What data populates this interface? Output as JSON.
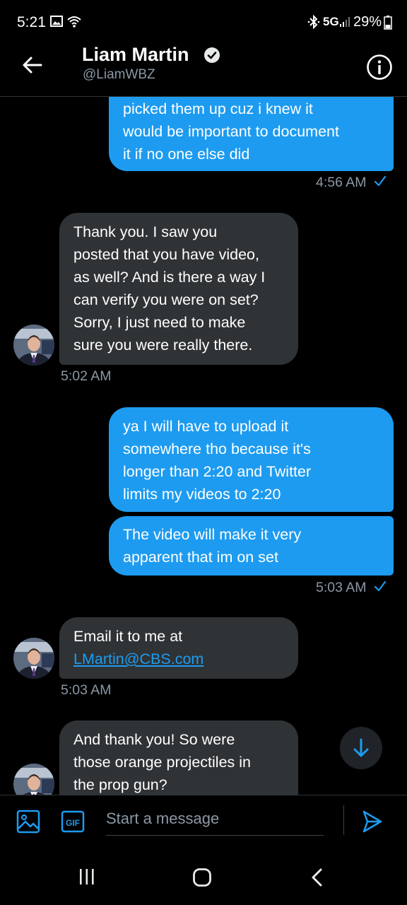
{
  "status_bar": {
    "time": "5:21",
    "network": "5G",
    "battery": "29%",
    "icons": [
      "gallery-icon",
      "wifi-icon",
      "bluetooth-icon",
      "signal-icon",
      "battery-icon"
    ]
  },
  "header": {
    "name": "Liam Martin",
    "handle": "@LiamWBZ",
    "verified": true,
    "back_icon": "arrow-left-icon",
    "info_icon": "info-icon"
  },
  "messages": [
    {
      "direction": "sent",
      "lines": [
        "picked them up cuz i knew it",
        "would be important to document",
        "it if no one else did"
      ]
    },
    {
      "type": "timestamp",
      "text": "4:56 AM",
      "read": true
    },
    {
      "direction": "received",
      "lines": [
        "Thank you. I saw you",
        "posted that you have video,",
        "as well? And is there a way I",
        "can verify you were on set?",
        "Sorry, I just need to make",
        "sure you were really there."
      ]
    },
    {
      "type": "timestamp",
      "text": "5:02 AM"
    },
    {
      "direction": "sent",
      "lines": [
        "ya I will have to upload it",
        "somewhere tho because it's",
        "longer than 2:20 and Twitter",
        "limits my videos to 2:20"
      ]
    },
    {
      "direction": "sent",
      "lines": [
        "The video will make it very",
        "apparent that im on set"
      ]
    },
    {
      "type": "timestamp",
      "text": "5:03 AM",
      "read": true
    },
    {
      "direction": "received",
      "lines": [
        "Email it to me at"
      ],
      "link": "LMartin@CBS.com"
    },
    {
      "type": "timestamp",
      "text": "5:03 AM"
    },
    {
      "direction": "received",
      "lines": [
        "And thank you! So were",
        "those orange projectiles in",
        "the prop gun?"
      ]
    }
  ],
  "composer": {
    "placeholder": "Start a message",
    "gif_label": "GIF",
    "icons": [
      "image-icon",
      "gif-icon",
      "send-icon"
    ]
  },
  "scroll_button_icon": "arrow-down-icon",
  "nav_bar": {
    "icons": [
      "recent-apps-icon",
      "home-icon",
      "back-icon"
    ]
  },
  "colors": {
    "accent": "#1d9bf0",
    "received_bubble": "#2f3336",
    "background": "#000000",
    "muted_text": "#8b98a5"
  }
}
